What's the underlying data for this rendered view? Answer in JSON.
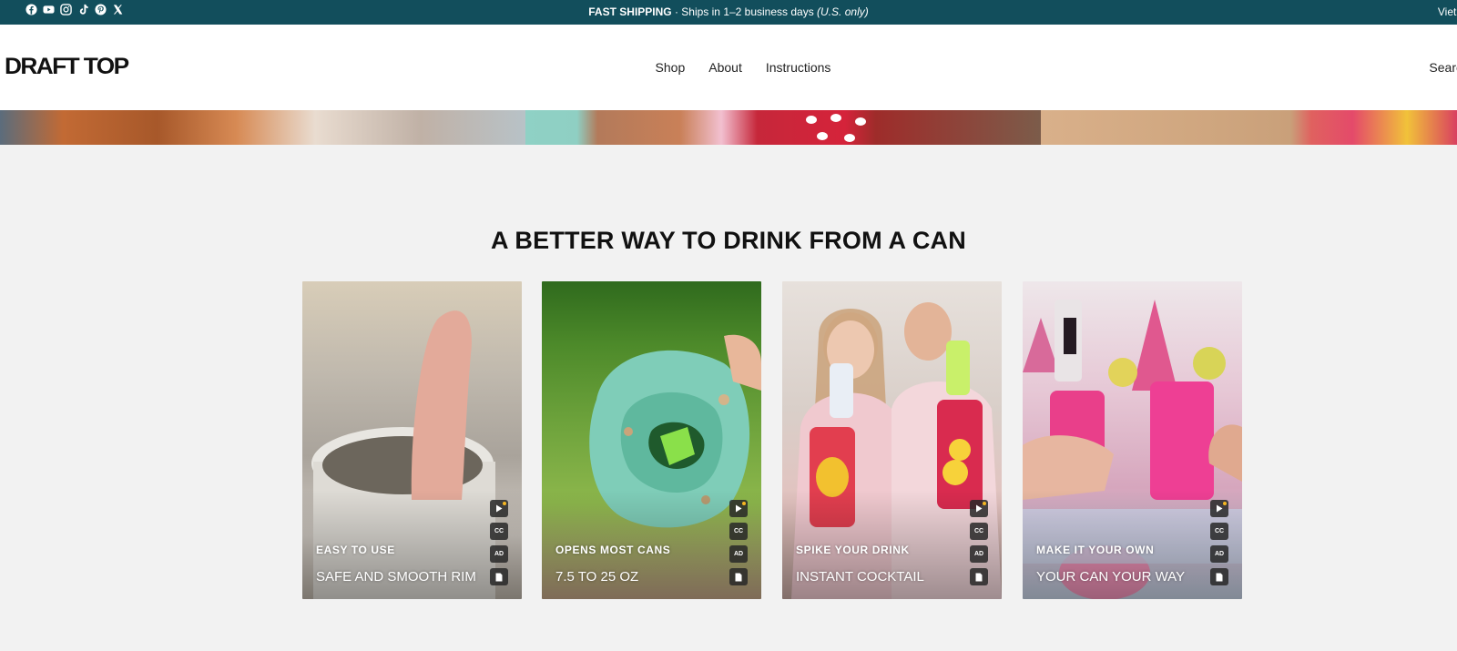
{
  "announcement": {
    "bold": "FAST SHIPPING",
    "text": " · Ships in 1–2 business days ",
    "italic": "(U.S. only)"
  },
  "country_selector": "Vietn",
  "socials": [
    "facebook-icon",
    "youtube-icon",
    "instagram-icon",
    "tiktok-icon",
    "pinterest-icon",
    "x-icon"
  ],
  "header": {
    "logo": "DRAFT TOP",
    "nav": [
      "Shop",
      "About",
      "Instructions"
    ],
    "search": "Searc"
  },
  "section": {
    "heading": "A BETTER WAY TO DRINK FROM A CAN",
    "cards": [
      {
        "subtitle": "EASY TO USE",
        "title": "SAFE AND SMOOTH RIM"
      },
      {
        "subtitle": "OPENS MOST CANS",
        "title": "7.5 TO 25 OZ"
      },
      {
        "subtitle": "SPIKE YOUR DRINK",
        "title": "INSTANT COCKTAIL"
      },
      {
        "subtitle": "MAKE IT YOUR OWN",
        "title": "YOUR CAN YOUR WAY"
      }
    ],
    "controls": {
      "cc": "CC",
      "ad": "AD"
    }
  },
  "colors": {
    "topbar": "#124e5c",
    "page_bg": "#f2f2f2"
  }
}
